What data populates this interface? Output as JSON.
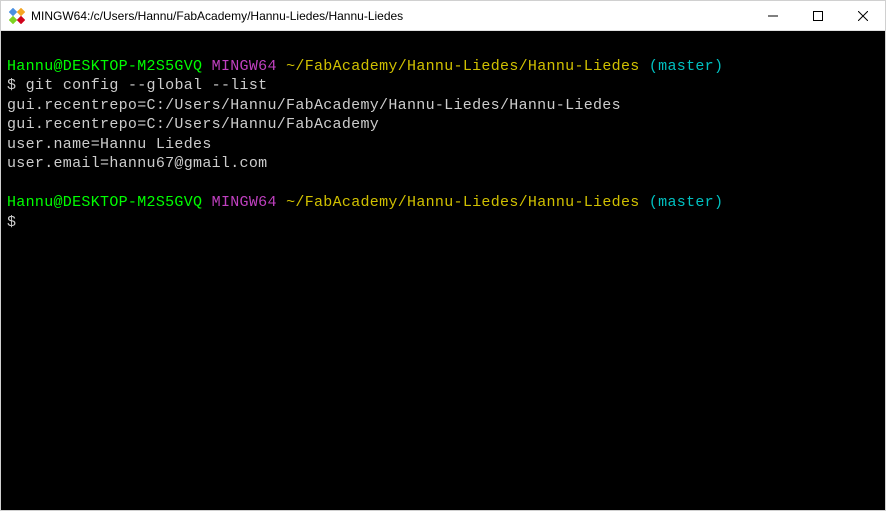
{
  "window": {
    "title": "MINGW64:/c/Users/Hannu/FabAcademy/Hannu-Liedes/Hannu-Liedes"
  },
  "prompt1": {
    "userHost": "Hannu@DESKTOP-M2S5GVQ",
    "mingw": "MINGW64",
    "path": "~/FabAcademy/Hannu-Liedes/Hannu-Liedes",
    "branch": "(master)",
    "dollar": "$",
    "command": "git config --global --list"
  },
  "output": {
    "line1": "gui.recentrepo=C:/Users/Hannu/FabAcademy/Hannu-Liedes/Hannu-Liedes",
    "line2": "gui.recentrepo=C:/Users/Hannu/FabAcademy",
    "line3": "user.name=Hannu Liedes",
    "line4": "user.email=hannu67@gmail.com"
  },
  "prompt2": {
    "userHost": "Hannu@DESKTOP-M2S5GVQ",
    "mingw": "MINGW64",
    "path": "~/FabAcademy/Hannu-Liedes/Hannu-Liedes",
    "branch": "(master)",
    "dollar": "$"
  }
}
